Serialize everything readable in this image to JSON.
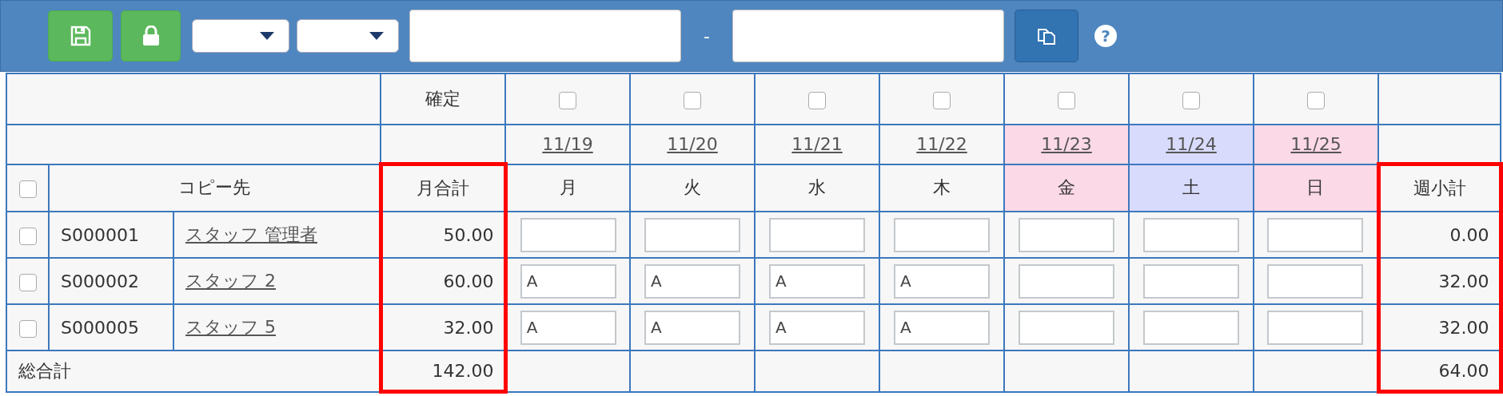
{
  "toolbar": {
    "range_separator": "-",
    "help_button": "?"
  },
  "table": {
    "confirm_label": "確定",
    "copy_target_label": "コピー先",
    "select_all_checked": false,
    "month_total": {
      "label": "月合計",
      "highlighted": true
    },
    "week_subtotal": {
      "label": "週小計",
      "highlighted": true
    },
    "days": [
      {
        "date": "11/19",
        "weekday": "月",
        "checked": false
      },
      {
        "date": "11/20",
        "weekday": "火",
        "checked": false
      },
      {
        "date": "11/21",
        "weekday": "水",
        "checked": false
      },
      {
        "date": "11/22",
        "weekday": "木",
        "checked": false
      },
      {
        "date": "11/23",
        "weekday": "金",
        "checked": false,
        "color": "#fcd9e7"
      },
      {
        "date": "11/24",
        "weekday": "土",
        "checked": false,
        "color": "#d9dbfd"
      },
      {
        "date": "11/25",
        "weekday": "日",
        "checked": false,
        "color": "#fcd9e7"
      }
    ],
    "rows": [
      {
        "checked": false,
        "code": "S000001",
        "name": "スタッフ 管理者",
        "month_total": "50.00",
        "week_subtotal": "0.00"
      },
      {
        "checked": false,
        "code": "S000002",
        "name": "スタッフ 2",
        "month_total": "60.00",
        "entries": [
          "A",
          "A",
          "A",
          "A"
        ],
        "week_subtotal": "32.00"
      },
      {
        "checked": false,
        "code": "S000005",
        "name": "スタッフ 5",
        "month_total": "32.00",
        "entries": [
          "A",
          "A",
          "A",
          "A"
        ],
        "week_subtotal": "32.00"
      }
    ],
    "totals": {
      "label": "総合計",
      "month_total": "142.00",
      "week_subtotal": "64.00"
    }
  }
}
